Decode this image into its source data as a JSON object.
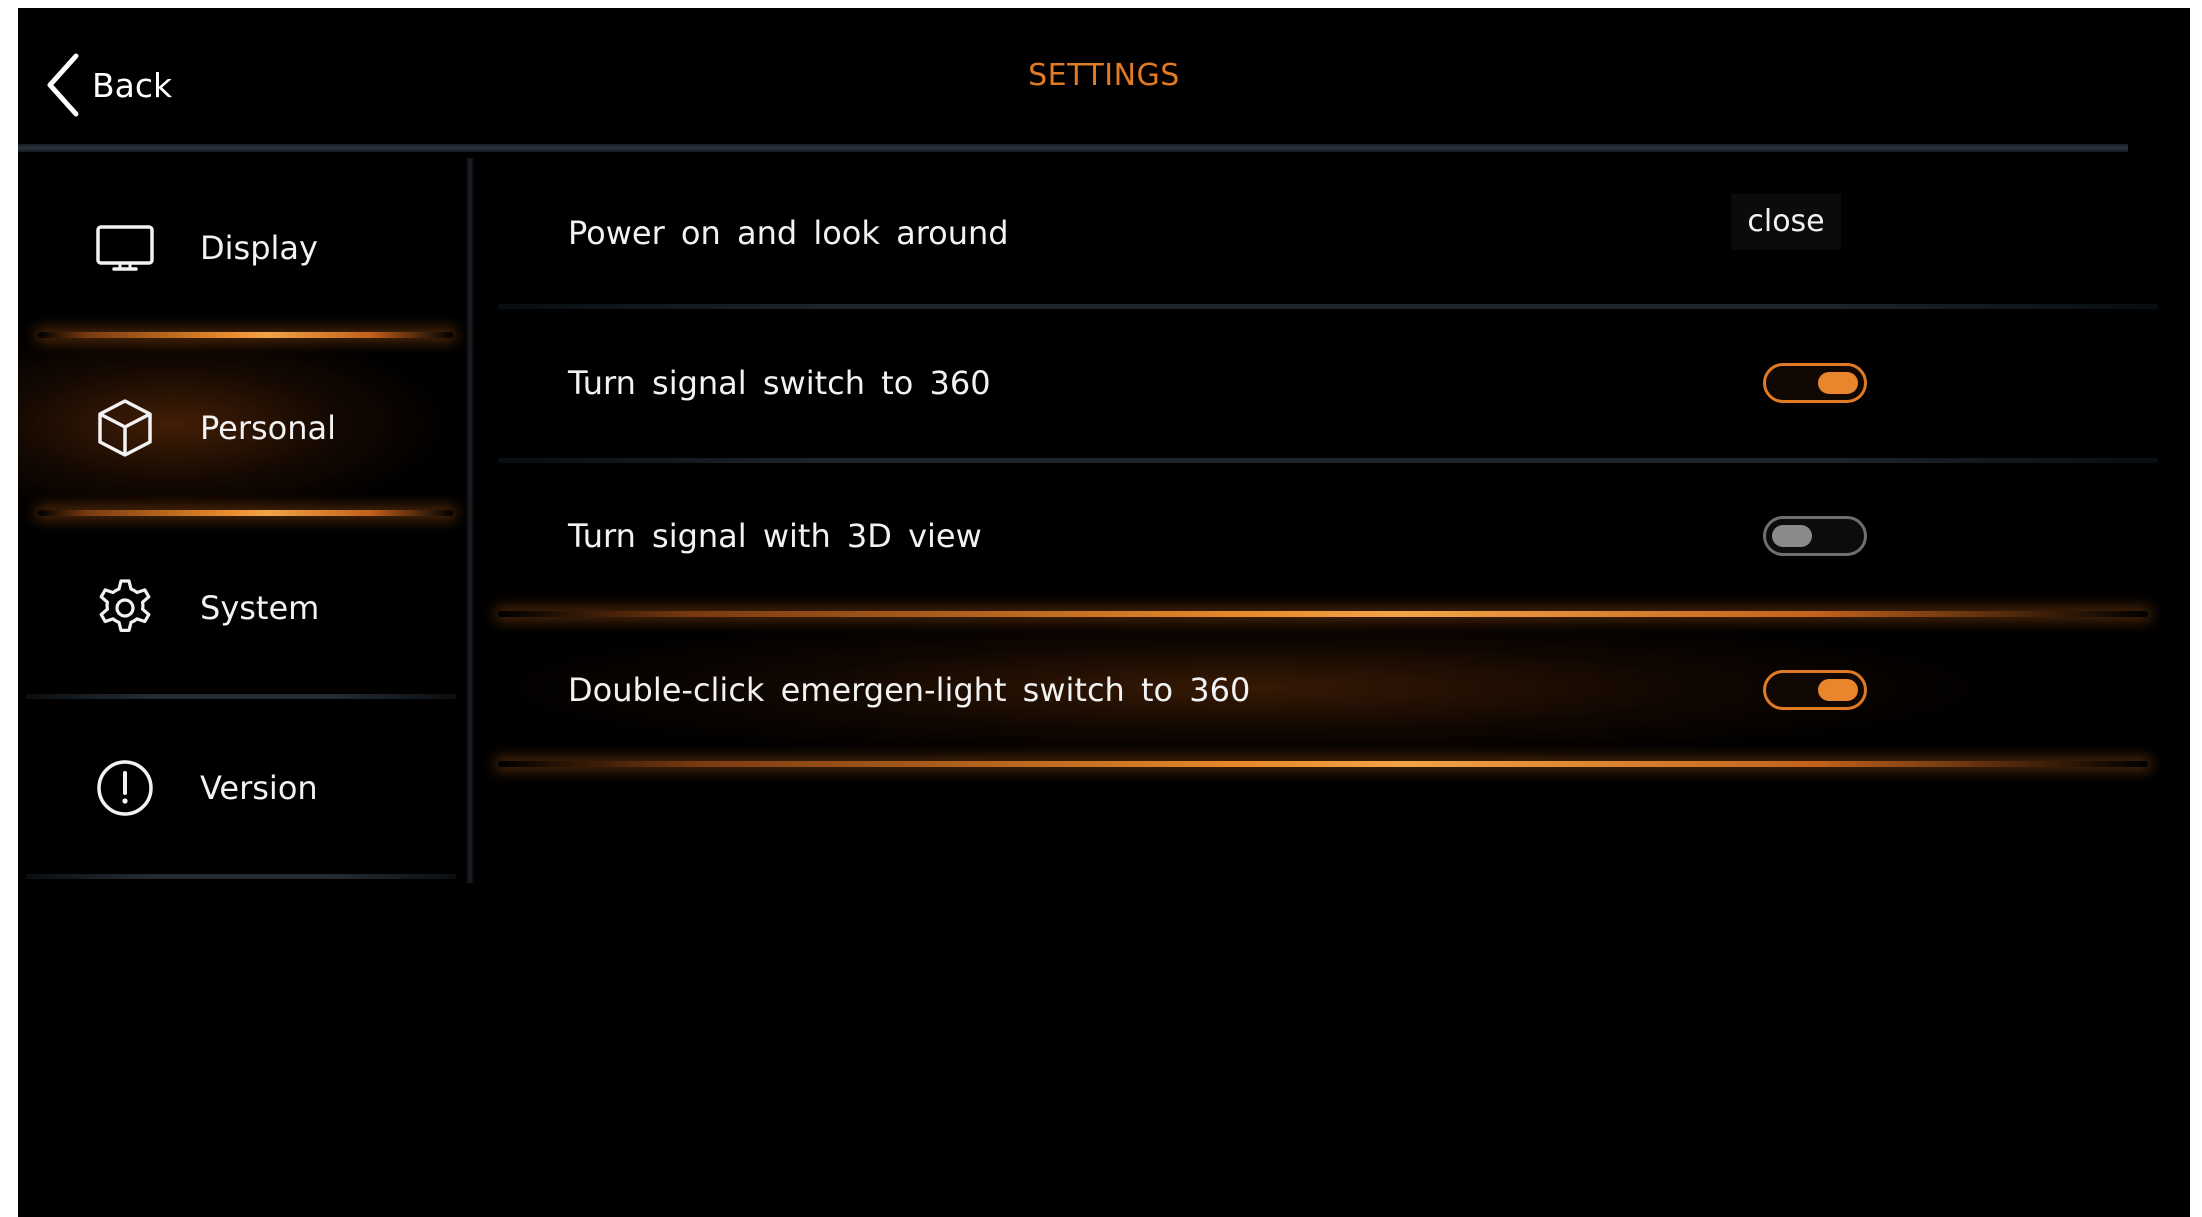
{
  "header": {
    "back_label": "Back",
    "title": "SETTINGS"
  },
  "sidebar": {
    "items": [
      {
        "label": "Display",
        "icon": "monitor-icon",
        "active": false
      },
      {
        "label": "Personal",
        "icon": "cube-icon",
        "active": true
      },
      {
        "label": "System",
        "icon": "gear-icon",
        "active": false
      },
      {
        "label": "Version",
        "icon": "info-exclamation-icon",
        "active": false
      }
    ]
  },
  "settings": {
    "rows": [
      {
        "label": "Power on and look around",
        "control": "value",
        "value": "close"
      },
      {
        "label": "Turn signal switch to 360",
        "control": "toggle",
        "state": "on"
      },
      {
        "label": "Turn signal with 3D view",
        "control": "toggle",
        "state": "off"
      },
      {
        "label": "Double-click emergen-light switch to 360",
        "control": "toggle",
        "state": "on",
        "highlighted": true
      }
    ]
  },
  "colors": {
    "accent": "#e07a24",
    "background": "#000000",
    "text": "#f2f2f2",
    "toggle_off": "#6f6f6f"
  }
}
